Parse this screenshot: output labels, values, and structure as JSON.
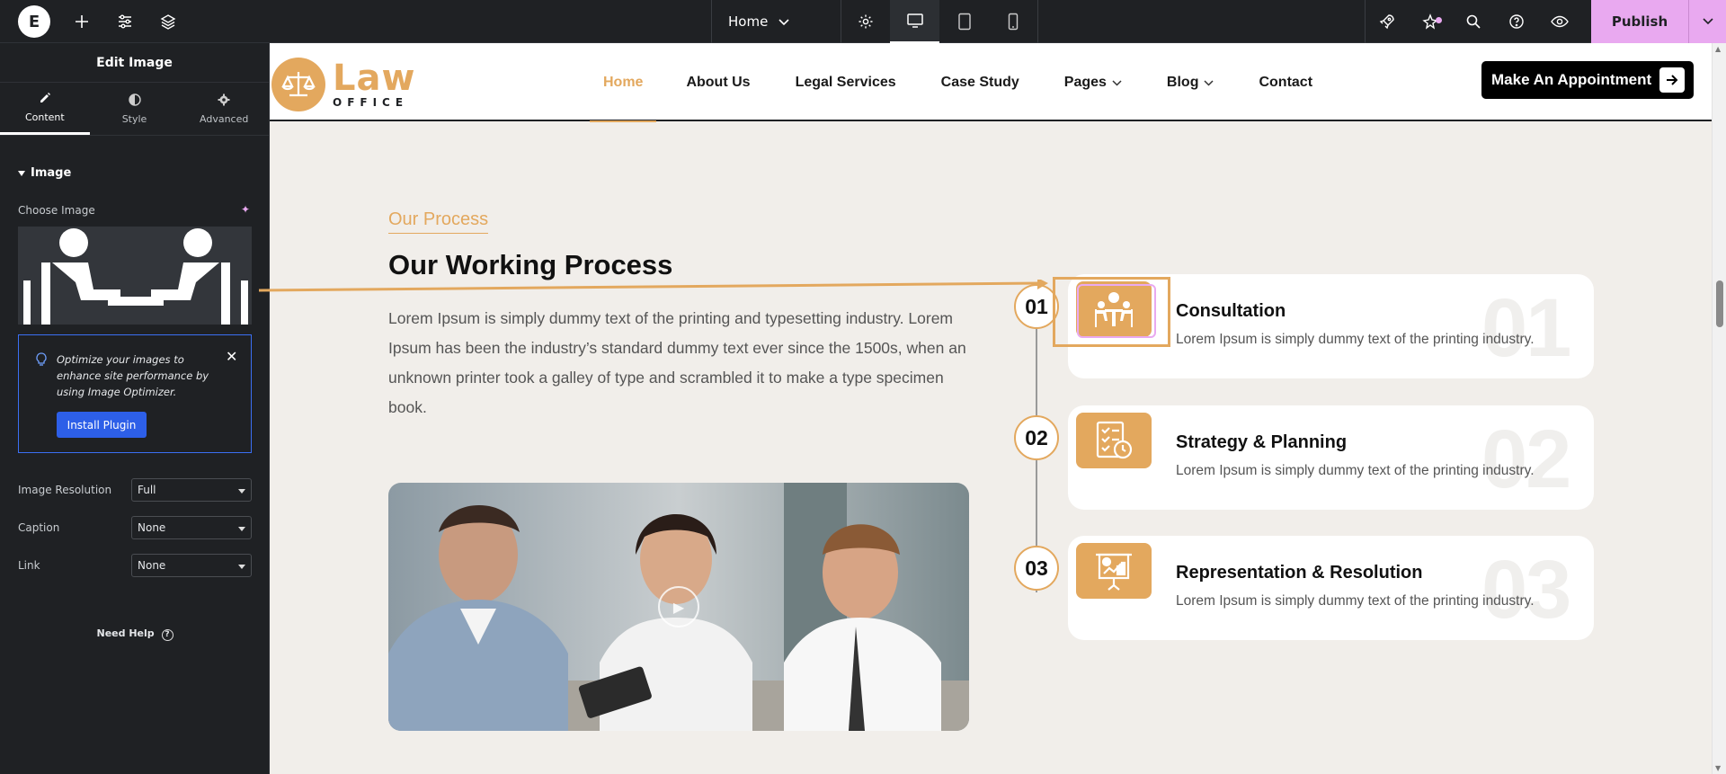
{
  "topbar": {
    "page_selector": "Home",
    "publish_label": "Publish"
  },
  "panel": {
    "title": "Edit Image",
    "tabs": [
      {
        "label": "Content"
      },
      {
        "label": "Style"
      },
      {
        "label": "Advanced"
      }
    ],
    "section": "Image",
    "choose_image_label": "Choose Image",
    "notice_text": "Optimize your images to enhance site performance by using Image Optimizer.",
    "install_button": "Install Plugin",
    "controls": [
      {
        "label": "Image Resolution",
        "value": "Full"
      },
      {
        "label": "Caption",
        "value": "None"
      },
      {
        "label": "Link",
        "value": "None"
      }
    ],
    "need_help": "Need Help"
  },
  "site": {
    "logo_main": "Law",
    "logo_sub": "OFFICE",
    "nav": [
      {
        "label": "Home",
        "active": true
      },
      {
        "label": "About Us"
      },
      {
        "label": "Legal Services"
      },
      {
        "label": "Case Study"
      },
      {
        "label": "Pages",
        "dropdown": true
      },
      {
        "label": "Blog",
        "dropdown": true
      },
      {
        "label": "Contact"
      }
    ],
    "cta_label": "Make An Appointment",
    "accent_color": "#e3a85e"
  },
  "process": {
    "eyebrow": "Our Process",
    "heading": "Our Working Process",
    "body": "Lorem Ipsum is simply dummy text of the printing and typesetting industry. Lorem Ipsum has been the industry’s standard dummy text ever since the 1500s, when an unknown printer took a galley of type and scrambled it to make a type specimen book.",
    "steps": [
      {
        "num": "01",
        "big": "01",
        "title": "Consultation",
        "desc": "Lorem Ipsum is simply dummy text of the printing industry.",
        "icon": "meeting-icon"
      },
      {
        "num": "02",
        "big": "02",
        "title": "Strategy & Planning",
        "desc": "Lorem Ipsum is simply dummy text of the printing industry.",
        "icon": "checklist-icon"
      },
      {
        "num": "03",
        "big": "03",
        "title": "Representation & Resolution",
        "desc": "Lorem Ipsum is simply dummy text of the printing industry.",
        "icon": "presentation-icon"
      }
    ]
  }
}
